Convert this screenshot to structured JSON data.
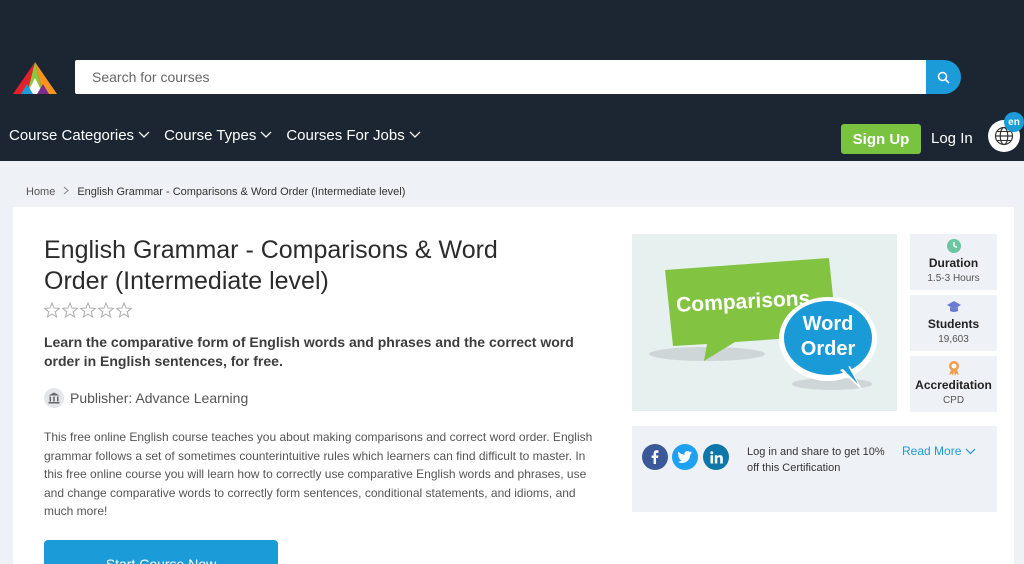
{
  "header": {
    "search_placeholder": "Search for courses",
    "nav": [
      {
        "label": "Course Categories"
      },
      {
        "label": "Course Types"
      },
      {
        "label": "Courses For Jobs"
      }
    ],
    "signup_label": "Sign Up",
    "login_label": "Log In",
    "language": "en"
  },
  "breadcrumb": {
    "home": "Home",
    "current": "English Grammar - Comparisons & Word Order (Intermediate level)"
  },
  "course": {
    "title": "English Grammar - Comparisons & Word Order (Intermediate level)",
    "rating_stars": 0,
    "subtitle": "Learn the comparative form of English words and phrases and the correct word order in English sentences, for free.",
    "publisher": "Publisher: Advance Learning",
    "description": "This free online English course teaches you about making comparisons and correct word order. English grammar follows a set of sometimes counterintuitive rules which learners can find difficult to master. In this free online course you will learn how to correctly use comparative English words and phrases, use and change comparative words to correctly form sentences, conditional statements, and idioms, and much more!",
    "start_label": "Start Course Now",
    "hero": {
      "bubble1": "Comparisons",
      "bubble2_line1": "Word",
      "bubble2_line2": "Order"
    }
  },
  "stats": [
    {
      "label": "Duration",
      "value": "1.5-3 Hours",
      "icon": "clock-icon"
    },
    {
      "label": "Students",
      "value": "19,603",
      "icon": "graduation-cap-icon"
    },
    {
      "label": "Accreditation",
      "value": "CPD",
      "icon": "award-icon"
    }
  ],
  "share": {
    "text": "Log in and share to get 10% off this Certification",
    "read_more": "Read More"
  },
  "colors": {
    "header_bg": "#1c2633",
    "accent_blue": "#1b9bd7",
    "signup_green": "#79c340",
    "bubble_green": "#82c341",
    "bubble_blue": "#1a9ad6"
  }
}
